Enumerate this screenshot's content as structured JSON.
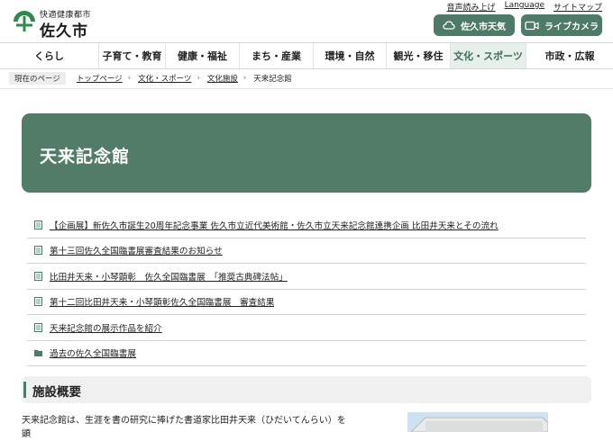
{
  "header": {
    "tagline": "快適健康都市",
    "city_name": "佐久市",
    "util_links": [
      "音声読み上げ",
      "Language",
      "サイトマップ"
    ],
    "weather_label": "佐久市天気",
    "camera_label": "ライブカメラ",
    "brand_color": "#4e7a68"
  },
  "gnav": [
    "くらし",
    "子育て・教育",
    "健康・福祉",
    "まち・産業",
    "環境・自然",
    "観光・移住",
    "文化・スポーツ",
    "市政・広報"
  ],
  "breadcrumb": {
    "current_label": "現在のページ",
    "items": [
      "トップページ",
      "文化・スポーツ",
      "文化施設",
      "天来記念館"
    ]
  },
  "page_title": "天来記念館",
  "links": [
    {
      "icon": "document-icon",
      "text": "【企画展】新佐久市誕生20周年記念事業 佐久市立近代美術館・佐久市立天来記念館連携企画 比田井天来とその流れ"
    },
    {
      "icon": "document-icon",
      "text": "第十三回佐久全国臨書展審査結果のお知らせ"
    },
    {
      "icon": "document-icon",
      "text": "比田井天来・小琴顕彰　佐久全国臨書展　「推奨古典碑法帖」"
    },
    {
      "icon": "document-icon",
      "text": "第十二回比田井天来・小琴顕彰佐久全国臨書展　審査結果"
    },
    {
      "icon": "document-icon",
      "text": "天来記念館の展示作品を紹介"
    },
    {
      "icon": "folder-icon",
      "text": "過去の佐久全国臨書展"
    }
  ],
  "section_heading": "施設概要",
  "body_text": "天来記念館は、生涯を書の研究に捧げた書道家比田井天来（ひだいてんらい）を顕"
}
